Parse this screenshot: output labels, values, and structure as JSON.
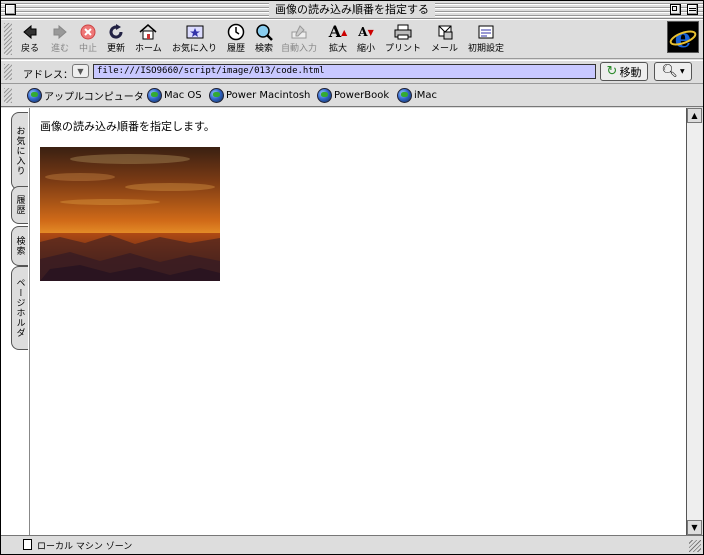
{
  "window": {
    "title": "画像の読み込み順番を指定する"
  },
  "toolbar": {
    "buttons": [
      {
        "label": "戻る",
        "icon": "back-arrow-icon",
        "enabled": true
      },
      {
        "label": "進む",
        "icon": "forward-arrow-icon",
        "enabled": false
      },
      {
        "label": "中止",
        "icon": "stop-icon",
        "enabled": false
      },
      {
        "label": "更新",
        "icon": "refresh-icon",
        "enabled": true
      },
      {
        "label": "ホーム",
        "icon": "home-icon",
        "enabled": true
      },
      {
        "label": "お気に入り",
        "icon": "favorites-icon",
        "enabled": true
      },
      {
        "label": "履歴",
        "icon": "history-icon",
        "enabled": true
      },
      {
        "label": "検索",
        "icon": "search-icon",
        "enabled": true
      },
      {
        "label": "自動入力",
        "icon": "autofill-icon",
        "enabled": false
      },
      {
        "label": "拡大",
        "icon": "larger-text-icon",
        "enabled": true
      },
      {
        "label": "縮小",
        "icon": "smaller-text-icon",
        "enabled": true
      },
      {
        "label": "プリント",
        "icon": "print-icon",
        "enabled": true
      },
      {
        "label": "メール",
        "icon": "mail-icon",
        "enabled": true
      },
      {
        "label": "初期設定",
        "icon": "preferences-icon",
        "enabled": true
      }
    ]
  },
  "address": {
    "label": "アドレス：",
    "url": "file:///ISO9660/script/image/013/code.html",
    "go_label": "移動"
  },
  "favorites": [
    "アップルコンピュータ",
    "Mac OS",
    "Power Macintosh",
    "PowerBook",
    "iMac"
  ],
  "sidetabs": [
    "お気に入り",
    "履歴",
    "検索",
    "ページホルダ"
  ],
  "page": {
    "heading": "画像の読み込み順番を指定します。"
  },
  "status": {
    "zone": "ローカル マシン ゾーン"
  },
  "colors": {
    "address_bg": "#c8c8ff",
    "chrome": "#dddddd",
    "ie_blue": "#1a64d8"
  }
}
